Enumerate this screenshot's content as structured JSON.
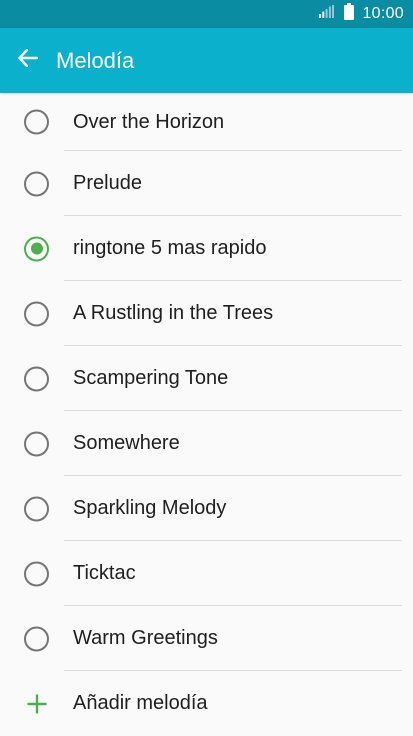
{
  "status_bar": {
    "time": "10:00",
    "icons": [
      "signal-icon",
      "battery-icon"
    ]
  },
  "header": {
    "title": "Melodía",
    "back_icon": "arrow-left-icon"
  },
  "ringtones": [
    {
      "label": "Over the Horizon",
      "selected": false
    },
    {
      "label": "Prelude",
      "selected": false
    },
    {
      "label": "ringtone 5 mas rapido",
      "selected": true
    },
    {
      "label": "A Rustling in the Trees",
      "selected": false
    },
    {
      "label": "Scampering Tone",
      "selected": false
    },
    {
      "label": "Somewhere",
      "selected": false
    },
    {
      "label": "Sparkling Melody",
      "selected": false
    },
    {
      "label": "Ticktac",
      "selected": false
    },
    {
      "label": "Warm Greetings",
      "selected": false
    }
  ],
  "add_ringtone": {
    "label": "Añadir melodía",
    "icon": "plus-icon"
  },
  "colors": {
    "status_bar": "#0a8ca3",
    "app_bar": "#0bb0cc",
    "accent": "#4caf50"
  }
}
